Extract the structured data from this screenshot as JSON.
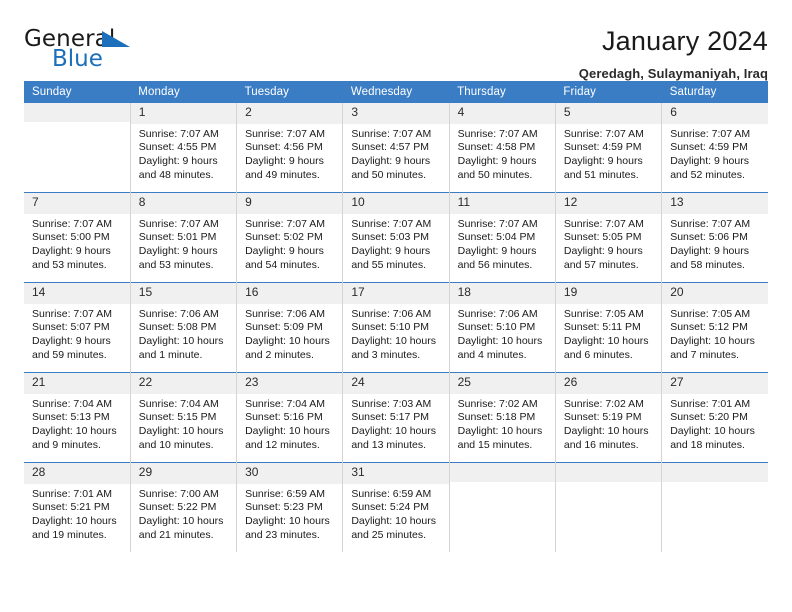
{
  "logo": {
    "word_one": "General",
    "word_two": "Blue",
    "accent_color": "#1c6fba",
    "triangle_icon": "triangle-icon"
  },
  "header": {
    "title": "January 2024",
    "subtitle": "Qeredagh, Sulaymaniyah, Iraq"
  },
  "calendar": {
    "header_bg": "#3b7dc4",
    "daynum_bg": "#f0f0f0",
    "weekday_headers": [
      "Sunday",
      "Monday",
      "Tuesday",
      "Wednesday",
      "Thursday",
      "Friday",
      "Saturday"
    ],
    "weeks": [
      [
        {
          "day": "",
          "sunrise": "",
          "sunset": "",
          "daylight_1": "",
          "daylight_2": ""
        },
        {
          "day": "1",
          "sunrise": "Sunrise: 7:07 AM",
          "sunset": "Sunset: 4:55 PM",
          "daylight_1": "Daylight: 9 hours",
          "daylight_2": "and 48 minutes."
        },
        {
          "day": "2",
          "sunrise": "Sunrise: 7:07 AM",
          "sunset": "Sunset: 4:56 PM",
          "daylight_1": "Daylight: 9 hours",
          "daylight_2": "and 49 minutes."
        },
        {
          "day": "3",
          "sunrise": "Sunrise: 7:07 AM",
          "sunset": "Sunset: 4:57 PM",
          "daylight_1": "Daylight: 9 hours",
          "daylight_2": "and 50 minutes."
        },
        {
          "day": "4",
          "sunrise": "Sunrise: 7:07 AM",
          "sunset": "Sunset: 4:58 PM",
          "daylight_1": "Daylight: 9 hours",
          "daylight_2": "and 50 minutes."
        },
        {
          "day": "5",
          "sunrise": "Sunrise: 7:07 AM",
          "sunset": "Sunset: 4:59 PM",
          "daylight_1": "Daylight: 9 hours",
          "daylight_2": "and 51 minutes."
        },
        {
          "day": "6",
          "sunrise": "Sunrise: 7:07 AM",
          "sunset": "Sunset: 4:59 PM",
          "daylight_1": "Daylight: 9 hours",
          "daylight_2": "and 52 minutes."
        }
      ],
      [
        {
          "day": "7",
          "sunrise": "Sunrise: 7:07 AM",
          "sunset": "Sunset: 5:00 PM",
          "daylight_1": "Daylight: 9 hours",
          "daylight_2": "and 53 minutes."
        },
        {
          "day": "8",
          "sunrise": "Sunrise: 7:07 AM",
          "sunset": "Sunset: 5:01 PM",
          "daylight_1": "Daylight: 9 hours",
          "daylight_2": "and 53 minutes."
        },
        {
          "day": "9",
          "sunrise": "Sunrise: 7:07 AM",
          "sunset": "Sunset: 5:02 PM",
          "daylight_1": "Daylight: 9 hours",
          "daylight_2": "and 54 minutes."
        },
        {
          "day": "10",
          "sunrise": "Sunrise: 7:07 AM",
          "sunset": "Sunset: 5:03 PM",
          "daylight_1": "Daylight: 9 hours",
          "daylight_2": "and 55 minutes."
        },
        {
          "day": "11",
          "sunrise": "Sunrise: 7:07 AM",
          "sunset": "Sunset: 5:04 PM",
          "daylight_1": "Daylight: 9 hours",
          "daylight_2": "and 56 minutes."
        },
        {
          "day": "12",
          "sunrise": "Sunrise: 7:07 AM",
          "sunset": "Sunset: 5:05 PM",
          "daylight_1": "Daylight: 9 hours",
          "daylight_2": "and 57 minutes."
        },
        {
          "day": "13",
          "sunrise": "Sunrise: 7:07 AM",
          "sunset": "Sunset: 5:06 PM",
          "daylight_1": "Daylight: 9 hours",
          "daylight_2": "and 58 minutes."
        }
      ],
      [
        {
          "day": "14",
          "sunrise": "Sunrise: 7:07 AM",
          "sunset": "Sunset: 5:07 PM",
          "daylight_1": "Daylight: 9 hours",
          "daylight_2": "and 59 minutes."
        },
        {
          "day": "15",
          "sunrise": "Sunrise: 7:06 AM",
          "sunset": "Sunset: 5:08 PM",
          "daylight_1": "Daylight: 10 hours",
          "daylight_2": "and 1 minute."
        },
        {
          "day": "16",
          "sunrise": "Sunrise: 7:06 AM",
          "sunset": "Sunset: 5:09 PM",
          "daylight_1": "Daylight: 10 hours",
          "daylight_2": "and 2 minutes."
        },
        {
          "day": "17",
          "sunrise": "Sunrise: 7:06 AM",
          "sunset": "Sunset: 5:10 PM",
          "daylight_1": "Daylight: 10 hours",
          "daylight_2": "and 3 minutes."
        },
        {
          "day": "18",
          "sunrise": "Sunrise: 7:06 AM",
          "sunset": "Sunset: 5:10 PM",
          "daylight_1": "Daylight: 10 hours",
          "daylight_2": "and 4 minutes."
        },
        {
          "day": "19",
          "sunrise": "Sunrise: 7:05 AM",
          "sunset": "Sunset: 5:11 PM",
          "daylight_1": "Daylight: 10 hours",
          "daylight_2": "and 6 minutes."
        },
        {
          "day": "20",
          "sunrise": "Sunrise: 7:05 AM",
          "sunset": "Sunset: 5:12 PM",
          "daylight_1": "Daylight: 10 hours",
          "daylight_2": "and 7 minutes."
        }
      ],
      [
        {
          "day": "21",
          "sunrise": "Sunrise: 7:04 AM",
          "sunset": "Sunset: 5:13 PM",
          "daylight_1": "Daylight: 10 hours",
          "daylight_2": "and 9 minutes."
        },
        {
          "day": "22",
          "sunrise": "Sunrise: 7:04 AM",
          "sunset": "Sunset: 5:15 PM",
          "daylight_1": "Daylight: 10 hours",
          "daylight_2": "and 10 minutes."
        },
        {
          "day": "23",
          "sunrise": "Sunrise: 7:04 AM",
          "sunset": "Sunset: 5:16 PM",
          "daylight_1": "Daylight: 10 hours",
          "daylight_2": "and 12 minutes."
        },
        {
          "day": "24",
          "sunrise": "Sunrise: 7:03 AM",
          "sunset": "Sunset: 5:17 PM",
          "daylight_1": "Daylight: 10 hours",
          "daylight_2": "and 13 minutes."
        },
        {
          "day": "25",
          "sunrise": "Sunrise: 7:02 AM",
          "sunset": "Sunset: 5:18 PM",
          "daylight_1": "Daylight: 10 hours",
          "daylight_2": "and 15 minutes."
        },
        {
          "day": "26",
          "sunrise": "Sunrise: 7:02 AM",
          "sunset": "Sunset: 5:19 PM",
          "daylight_1": "Daylight: 10 hours",
          "daylight_2": "and 16 minutes."
        },
        {
          "day": "27",
          "sunrise": "Sunrise: 7:01 AM",
          "sunset": "Sunset: 5:20 PM",
          "daylight_1": "Daylight: 10 hours",
          "daylight_2": "and 18 minutes."
        }
      ],
      [
        {
          "day": "28",
          "sunrise": "Sunrise: 7:01 AM",
          "sunset": "Sunset: 5:21 PM",
          "daylight_1": "Daylight: 10 hours",
          "daylight_2": "and 19 minutes."
        },
        {
          "day": "29",
          "sunrise": "Sunrise: 7:00 AM",
          "sunset": "Sunset: 5:22 PM",
          "daylight_1": "Daylight: 10 hours",
          "daylight_2": "and 21 minutes."
        },
        {
          "day": "30",
          "sunrise": "Sunrise: 6:59 AM",
          "sunset": "Sunset: 5:23 PM",
          "daylight_1": "Daylight: 10 hours",
          "daylight_2": "and 23 minutes."
        },
        {
          "day": "31",
          "sunrise": "Sunrise: 6:59 AM",
          "sunset": "Sunset: 5:24 PM",
          "daylight_1": "Daylight: 10 hours",
          "daylight_2": "and 25 minutes."
        },
        {
          "day": "",
          "sunrise": "",
          "sunset": "",
          "daylight_1": "",
          "daylight_2": ""
        },
        {
          "day": "",
          "sunrise": "",
          "sunset": "",
          "daylight_1": "",
          "daylight_2": ""
        },
        {
          "day": "",
          "sunrise": "",
          "sunset": "",
          "daylight_1": "",
          "daylight_2": ""
        }
      ]
    ]
  }
}
